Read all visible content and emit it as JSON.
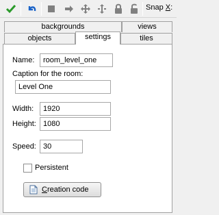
{
  "toolbar": {
    "buttons": [
      {
        "name": "ok-checkmark-icon",
        "color": "#2a9a2a"
      },
      {
        "name": "undo-icon",
        "color": "#1a63c8"
      },
      {
        "name": "delete-icon",
        "color": "#7a7a7a"
      },
      {
        "name": "shift-icon",
        "color": "#7a7a7a"
      },
      {
        "name": "move-all-icon",
        "color": "#7a7a7a"
      },
      {
        "name": "move-vertical-icon",
        "color": "#7a7a7a"
      },
      {
        "name": "lock-icon",
        "color": "#7a7a7a"
      },
      {
        "name": "unlock-icon",
        "color": "#7a7a7a"
      }
    ],
    "snap_label_prefix": "Snap ",
    "snap_label_hotkey": "X",
    "snap_label_suffix": ":"
  },
  "tabs": {
    "back_row": [
      "backgrounds",
      "views"
    ],
    "front_row": [
      "objects",
      "settings",
      "tiles"
    ],
    "active": "settings"
  },
  "settings": {
    "name_label": "Name:",
    "name_value": "room_level_one",
    "caption_label": "Caption for the room:",
    "caption_value": "Level One",
    "width_label": "Width:",
    "width_value": "1920",
    "height_label": "Height:",
    "height_value": "1080",
    "speed_label": "Speed:",
    "speed_value": "30",
    "persistent_label": "Persistent",
    "persistent_checked": false,
    "creation_code_hotkey": "C",
    "creation_code_rest": "reation code"
  }
}
